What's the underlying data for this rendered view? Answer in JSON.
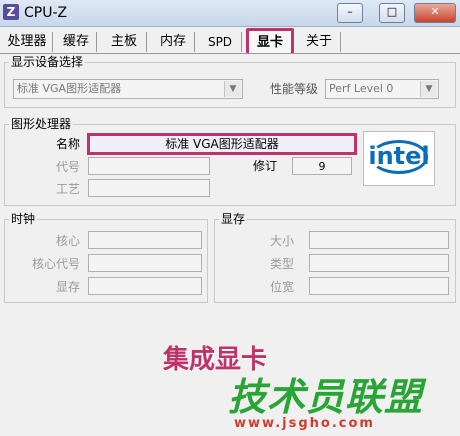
{
  "window": {
    "title": "CPU-Z",
    "icon_letter": "Z",
    "min": "–",
    "max": "□",
    "close": "✕"
  },
  "tabs": [
    "处理器",
    "缓存",
    "主板",
    "内存",
    "SPD",
    "显卡",
    "关于"
  ],
  "active_tab": "显卡",
  "display_select": {
    "title": "显示设备选择",
    "device": "标准 VGA图形适配器",
    "perf_label": "性能等级",
    "perf_value": "Perf Level 0"
  },
  "gpu": {
    "title": "图形处理器",
    "name_label": "名称",
    "name_value": "标准 VGA图形适配器",
    "code_label": "代号",
    "code_value": "",
    "revision_label": "修订",
    "revision_value": "9",
    "process_label": "工艺",
    "process_value": "",
    "logo": "intel"
  },
  "clock": {
    "title": "时钟",
    "core": "核心",
    "shader": "核心代号",
    "memory": "显存"
  },
  "memory": {
    "title": "显存",
    "size": "大小",
    "type": "类型",
    "width": "位宽"
  },
  "annotation": "集成显卡",
  "watermark": {
    "text": "技术员联盟",
    "url": "www.jsgho.com"
  },
  "colors": {
    "highlight": "#c0336a",
    "intel_blue": "#0a6db8",
    "watermark_green": "#29a436"
  }
}
